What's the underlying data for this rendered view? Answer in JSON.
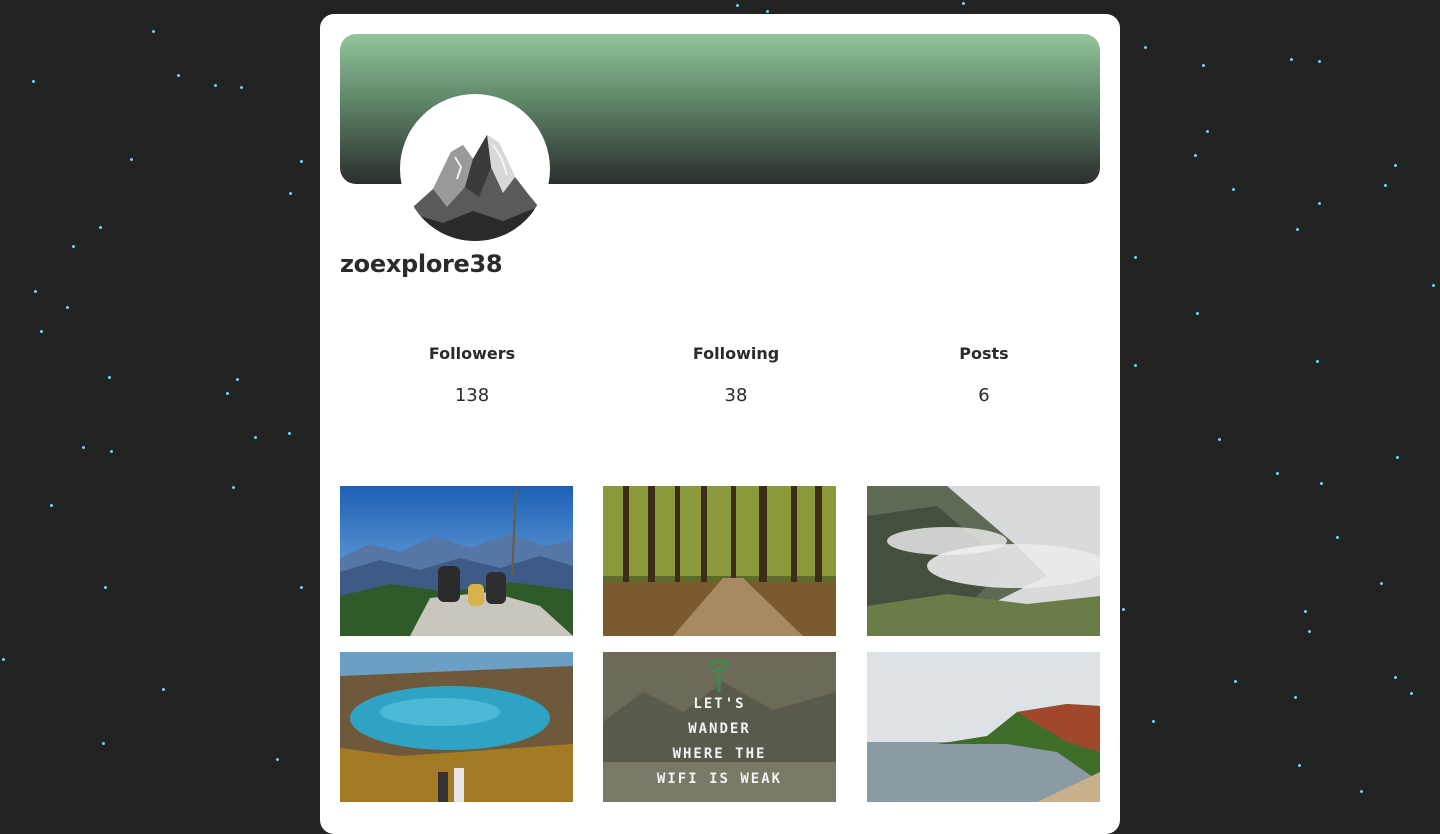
{
  "profile": {
    "username": "zoexplore38",
    "avatar_icon": "mountain-peak-icon"
  },
  "stats": {
    "followers": {
      "label": "Followers",
      "value": "138"
    },
    "following": {
      "label": "Following",
      "value": "38"
    },
    "posts": {
      "label": "Posts",
      "value": "6"
    }
  },
  "posts": {
    "quote_post": {
      "icon": "tree-wifi-icon",
      "lines": [
        "LET'S",
        "WANDER",
        "WHERE THE",
        "WIFI IS WEAK"
      ]
    }
  },
  "colors": {
    "background": "#222222",
    "card": "#ffffff",
    "banner_top": "#93c59a",
    "banner_bottom": "#2b2e2c",
    "star": "#6fd3e6"
  }
}
